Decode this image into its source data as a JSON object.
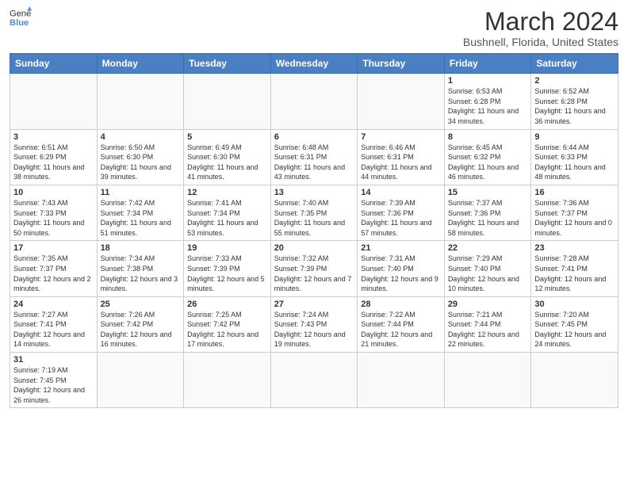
{
  "header": {
    "logo_general": "General",
    "logo_blue": "Blue",
    "month_title": "March 2024",
    "location": "Bushnell, Florida, United States"
  },
  "weekdays": [
    "Sunday",
    "Monday",
    "Tuesday",
    "Wednesday",
    "Thursday",
    "Friday",
    "Saturday"
  ],
  "weeks": [
    [
      {
        "day": "",
        "info": ""
      },
      {
        "day": "",
        "info": ""
      },
      {
        "day": "",
        "info": ""
      },
      {
        "day": "",
        "info": ""
      },
      {
        "day": "",
        "info": ""
      },
      {
        "day": "1",
        "info": "Sunrise: 6:53 AM\nSunset: 6:28 PM\nDaylight: 11 hours and 34 minutes."
      },
      {
        "day": "2",
        "info": "Sunrise: 6:52 AM\nSunset: 6:28 PM\nDaylight: 11 hours and 36 minutes."
      }
    ],
    [
      {
        "day": "3",
        "info": "Sunrise: 6:51 AM\nSunset: 6:29 PM\nDaylight: 11 hours and 38 minutes."
      },
      {
        "day": "4",
        "info": "Sunrise: 6:50 AM\nSunset: 6:30 PM\nDaylight: 11 hours and 39 minutes."
      },
      {
        "day": "5",
        "info": "Sunrise: 6:49 AM\nSunset: 6:30 PM\nDaylight: 11 hours and 41 minutes."
      },
      {
        "day": "6",
        "info": "Sunrise: 6:48 AM\nSunset: 6:31 PM\nDaylight: 11 hours and 43 minutes."
      },
      {
        "day": "7",
        "info": "Sunrise: 6:46 AM\nSunset: 6:31 PM\nDaylight: 11 hours and 44 minutes."
      },
      {
        "day": "8",
        "info": "Sunrise: 6:45 AM\nSunset: 6:32 PM\nDaylight: 11 hours and 46 minutes."
      },
      {
        "day": "9",
        "info": "Sunrise: 6:44 AM\nSunset: 6:33 PM\nDaylight: 11 hours and 48 minutes."
      }
    ],
    [
      {
        "day": "10",
        "info": "Sunrise: 7:43 AM\nSunset: 7:33 PM\nDaylight: 11 hours and 50 minutes."
      },
      {
        "day": "11",
        "info": "Sunrise: 7:42 AM\nSunset: 7:34 PM\nDaylight: 11 hours and 51 minutes."
      },
      {
        "day": "12",
        "info": "Sunrise: 7:41 AM\nSunset: 7:34 PM\nDaylight: 11 hours and 53 minutes."
      },
      {
        "day": "13",
        "info": "Sunrise: 7:40 AM\nSunset: 7:35 PM\nDaylight: 11 hours and 55 minutes."
      },
      {
        "day": "14",
        "info": "Sunrise: 7:39 AM\nSunset: 7:36 PM\nDaylight: 11 hours and 57 minutes."
      },
      {
        "day": "15",
        "info": "Sunrise: 7:37 AM\nSunset: 7:36 PM\nDaylight: 11 hours and 58 minutes."
      },
      {
        "day": "16",
        "info": "Sunrise: 7:36 AM\nSunset: 7:37 PM\nDaylight: 12 hours and 0 minutes."
      }
    ],
    [
      {
        "day": "17",
        "info": "Sunrise: 7:35 AM\nSunset: 7:37 PM\nDaylight: 12 hours and 2 minutes."
      },
      {
        "day": "18",
        "info": "Sunrise: 7:34 AM\nSunset: 7:38 PM\nDaylight: 12 hours and 3 minutes."
      },
      {
        "day": "19",
        "info": "Sunrise: 7:33 AM\nSunset: 7:39 PM\nDaylight: 12 hours and 5 minutes."
      },
      {
        "day": "20",
        "info": "Sunrise: 7:32 AM\nSunset: 7:39 PM\nDaylight: 12 hours and 7 minutes."
      },
      {
        "day": "21",
        "info": "Sunrise: 7:31 AM\nSunset: 7:40 PM\nDaylight: 12 hours and 9 minutes."
      },
      {
        "day": "22",
        "info": "Sunrise: 7:29 AM\nSunset: 7:40 PM\nDaylight: 12 hours and 10 minutes."
      },
      {
        "day": "23",
        "info": "Sunrise: 7:28 AM\nSunset: 7:41 PM\nDaylight: 12 hours and 12 minutes."
      }
    ],
    [
      {
        "day": "24",
        "info": "Sunrise: 7:27 AM\nSunset: 7:41 PM\nDaylight: 12 hours and 14 minutes."
      },
      {
        "day": "25",
        "info": "Sunrise: 7:26 AM\nSunset: 7:42 PM\nDaylight: 12 hours and 16 minutes."
      },
      {
        "day": "26",
        "info": "Sunrise: 7:25 AM\nSunset: 7:42 PM\nDaylight: 12 hours and 17 minutes."
      },
      {
        "day": "27",
        "info": "Sunrise: 7:24 AM\nSunset: 7:43 PM\nDaylight: 12 hours and 19 minutes."
      },
      {
        "day": "28",
        "info": "Sunrise: 7:22 AM\nSunset: 7:44 PM\nDaylight: 12 hours and 21 minutes."
      },
      {
        "day": "29",
        "info": "Sunrise: 7:21 AM\nSunset: 7:44 PM\nDaylight: 12 hours and 22 minutes."
      },
      {
        "day": "30",
        "info": "Sunrise: 7:20 AM\nSunset: 7:45 PM\nDaylight: 12 hours and 24 minutes."
      }
    ],
    [
      {
        "day": "31",
        "info": "Sunrise: 7:19 AM\nSunset: 7:45 PM\nDaylight: 12 hours and 26 minutes."
      },
      {
        "day": "",
        "info": ""
      },
      {
        "day": "",
        "info": ""
      },
      {
        "day": "",
        "info": ""
      },
      {
        "day": "",
        "info": ""
      },
      {
        "day": "",
        "info": ""
      },
      {
        "day": "",
        "info": ""
      }
    ]
  ]
}
